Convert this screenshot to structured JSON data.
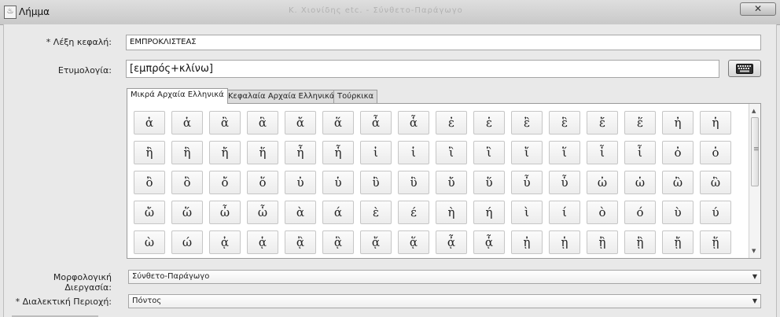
{
  "window": {
    "title": "Λήμμα",
    "title_blurred": "Κ. Χιονίδης etc. - Σύνθετο-Παράγωγο",
    "close_glyph": "✕",
    "app_icon_glyph": "♨"
  },
  "form": {
    "head_word": {
      "label": "* Λέξη κεφαλή:",
      "value": "ΕΜΠΡΟΚΛΙΣΤΕΑΣ"
    },
    "etymology": {
      "label": "Ετυμολογία:",
      "value": "[εμπρός+κλίνω]"
    },
    "morphology": {
      "label": "Μορφολογική Διεργασία:",
      "value": "Σύνθετο-Παράγωγο"
    },
    "dialect": {
      "label": "* Διαλεκτική Περιοχή:",
      "value": "Πόντος"
    }
  },
  "tabs": [
    "Μικρά Αρχαία Ελληνικά",
    "Κεφαλαία Αρχαία Ελληνικά",
    "Τούρκικα"
  ],
  "active_tab": 0,
  "icons": {
    "keyboard": "keyboard-icon",
    "scroll_up": "▲",
    "scroll_down": "▼",
    "grip": "≡",
    "combo_arrow": "▼"
  },
  "characters": [
    [
      "ἀ",
      "ἁ",
      "ἂ",
      "ἃ",
      "ἄ",
      "ἅ",
      "ἆ",
      "ἇ",
      "ἐ",
      "ἑ",
      "ἒ",
      "ἓ",
      "ἔ",
      "ἕ",
      "ἠ",
      "ἡ"
    ],
    [
      "ἢ",
      "ἣ",
      "ἤ",
      "ἥ",
      "ἦ",
      "ἧ",
      "ἰ",
      "ἱ",
      "ἲ",
      "ἳ",
      "ἴ",
      "ἵ",
      "ἶ",
      "ἷ",
      "ὀ",
      "ὁ"
    ],
    [
      "ὂ",
      "ὃ",
      "ὄ",
      "ὅ",
      "ὐ",
      "ὑ",
      "ὒ",
      "ὓ",
      "ὔ",
      "ὕ",
      "ὖ",
      "ὗ",
      "ὠ",
      "ὡ",
      "ὢ",
      "ὣ"
    ],
    [
      "ὤ",
      "ὥ",
      "ὦ",
      "ὧ",
      "ὰ",
      "ά",
      "ὲ",
      "έ",
      "ὴ",
      "ή",
      "ὶ",
      "ί",
      "ὸ",
      "ό",
      "ὺ",
      "ύ"
    ],
    [
      "ὼ",
      "ώ",
      "ᾀ",
      "ᾁ",
      "ᾂ",
      "ᾃ",
      "ᾄ",
      "ᾅ",
      "ᾆ",
      "ᾇ",
      "ᾐ",
      "ᾑ",
      "ᾒ",
      "ᾓ",
      "ᾔ",
      "ᾕ"
    ]
  ]
}
